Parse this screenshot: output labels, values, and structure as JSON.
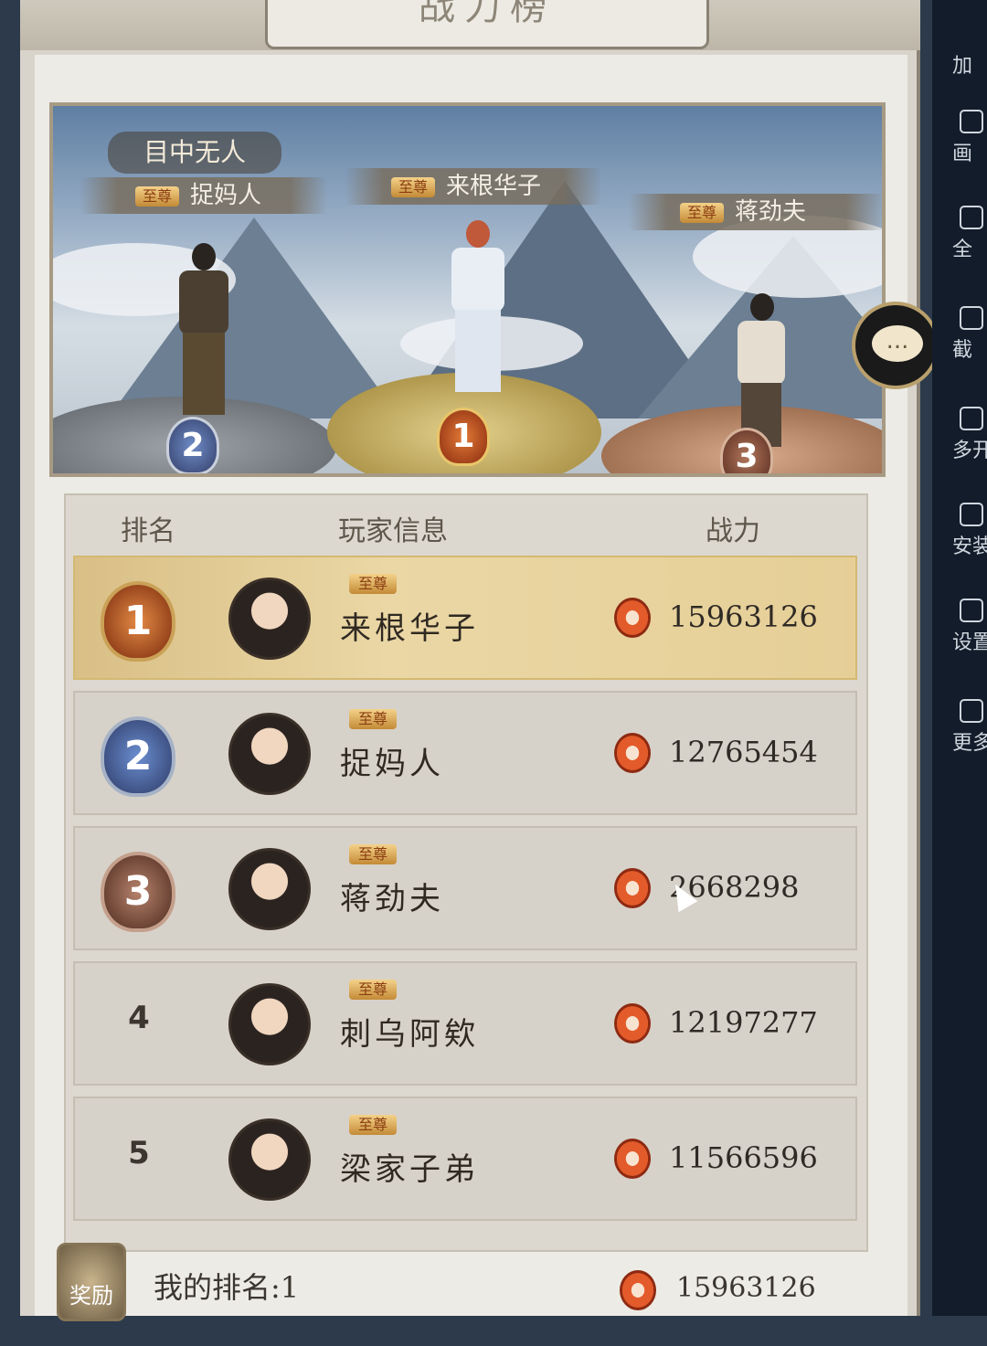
{
  "panel": {
    "title": "战力榜"
  },
  "banner": {
    "logo_text": "目中无人",
    "podium": [
      {
        "rank": "2",
        "title_tag": "至尊",
        "name": "捉妈人"
      },
      {
        "rank": "1",
        "title_tag": "至尊",
        "name": "来根华子"
      },
      {
        "rank": "3",
        "title_tag": "至尊",
        "name": "蒋劲夫"
      }
    ]
  },
  "table": {
    "headers": {
      "rank": "排名",
      "player": "玩家信息",
      "power": "战力"
    },
    "rows": [
      {
        "rank": "1",
        "title_tag": "至尊",
        "name": "来根华子",
        "power": "15963126"
      },
      {
        "rank": "2",
        "title_tag": "至尊",
        "name": "捉妈人",
        "power": "12765454"
      },
      {
        "rank": "3",
        "title_tag": "至尊",
        "name": "蒋劲夫",
        "power": "2668298"
      },
      {
        "rank": "4",
        "title_tag": "至尊",
        "name": "刺乌阿欸",
        "power": "12197277"
      },
      {
        "rank": "5",
        "title_tag": "至尊",
        "name": "梁家子弟",
        "power": "11566596"
      }
    ]
  },
  "footer": {
    "reward_label": "奖励",
    "my_rank": "我的排名:1",
    "my_power": "15963126"
  },
  "chat": {
    "icon_text": "..."
  },
  "sidebar": {
    "items": [
      {
        "label": "加"
      },
      {
        "label": "画"
      },
      {
        "label": "全"
      },
      {
        "label": "截"
      },
      {
        "label": "多开"
      },
      {
        "label": "安装"
      },
      {
        "label": "设置"
      },
      {
        "label": "更多"
      }
    ]
  }
}
